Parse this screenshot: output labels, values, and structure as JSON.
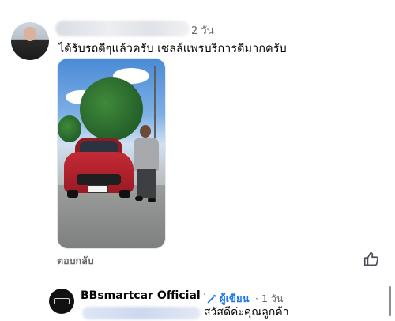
{
  "comment": {
    "time": "2 วัน",
    "text": "ได้รับรถดีๆแล้วครับ เซลล์แพรบริการดีมากครับ",
    "reply_label": "ตอบกลับ"
  },
  "reply": {
    "author": "BBsmartcar Official",
    "author_badge": "ผู้เขียน",
    "separator": "·",
    "time": "· 1 วัน",
    "text": "สวัสดีค่ะคุณลูกค้า"
  },
  "colors": {
    "accent": "#1877f2",
    "secondary_text": "#65676b"
  },
  "icons": {
    "like": "thumbs-up-icon",
    "author_badge": "pencil-icon"
  }
}
